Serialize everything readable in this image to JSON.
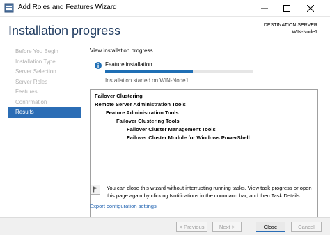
{
  "window": {
    "title": "Add Roles and Features Wizard"
  },
  "header": {
    "page_title": "Installation progress",
    "destination_label": "DESTINATION SERVER",
    "destination_server": "WIN-Node1"
  },
  "nav": {
    "items": [
      {
        "label": "Before You Begin",
        "active": false
      },
      {
        "label": "Installation Type",
        "active": false
      },
      {
        "label": "Server Selection",
        "active": false
      },
      {
        "label": "Server Roles",
        "active": false
      },
      {
        "label": "Features",
        "active": false
      },
      {
        "label": "Confirmation",
        "active": false
      },
      {
        "label": "Results",
        "active": true
      }
    ]
  },
  "main": {
    "view_label": "View installation progress",
    "feature_installation": "Feature installation",
    "progress_fraction": 0.59,
    "install_started": "Installation started on WIN-Node1",
    "tree": [
      {
        "text": "Failover Clustering",
        "level": 0
      },
      {
        "text": "Remote Server Administration Tools",
        "level": 0
      },
      {
        "text": "Feature Administration Tools",
        "level": 1
      },
      {
        "text": "Failover Clustering Tools",
        "level": 2
      },
      {
        "text": "Failover Cluster Management Tools",
        "level": 3
      },
      {
        "text": "Failover Cluster Module for Windows PowerShell",
        "level": 3
      }
    ],
    "note": "You can close this wizard without interrupting running tasks. View task progress or open this page again by clicking Notifications in the command bar, and then Task Details.",
    "export_link": "Export configuration settings"
  },
  "footer": {
    "previous": "< Previous",
    "next": "Next >",
    "close": "Close",
    "cancel": "Cancel"
  },
  "colors": {
    "accent": "#2b6db5",
    "progress": "#1f6fb5",
    "title": "#1e3a5f",
    "link": "#2163b1"
  },
  "icons": {
    "app": "server-manager-icon",
    "info": "info-icon",
    "note": "notification-flag-icon"
  }
}
